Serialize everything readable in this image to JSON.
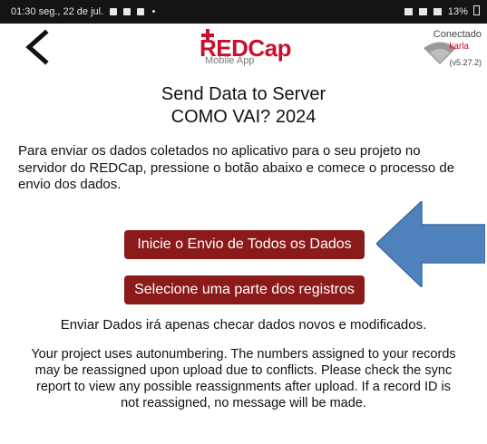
{
  "status_bar": {
    "time_date": "01:30  seg., 22 de jul.",
    "battery": "13%"
  },
  "header": {
    "logo_text": "REDCap",
    "logo_subtitle": "Mobile App",
    "connection_status": "Conectado",
    "user": "karla",
    "version": "(v5.27.2)"
  },
  "title": {
    "line1": "Send Data to Server",
    "line2": "COMO VAI? 2024"
  },
  "instructions": "Para enviar os dados coletados no aplicativo para o seu projeto no servidor do REDCap, pressione o botão abaixo e comece o processo de envio dos dados.",
  "buttons": {
    "send_all": "Inicie o Envio de Todos os Dados",
    "select_part": "Selecione uma parte dos registros"
  },
  "note": "Enviar Dados irá apenas checar dados novos e modificados.",
  "warning": "Your project uses autonumbering. The numbers assigned to your records may be reassigned upon upload due to conflicts. Please check the sync report to view any possible reassignments after upload. If a record ID is not reassigned, no message will be made.",
  "colors": {
    "brand_red": "#c8102e",
    "button_bg": "#8b1a1a",
    "arrow_blue": "#4f81bd"
  }
}
